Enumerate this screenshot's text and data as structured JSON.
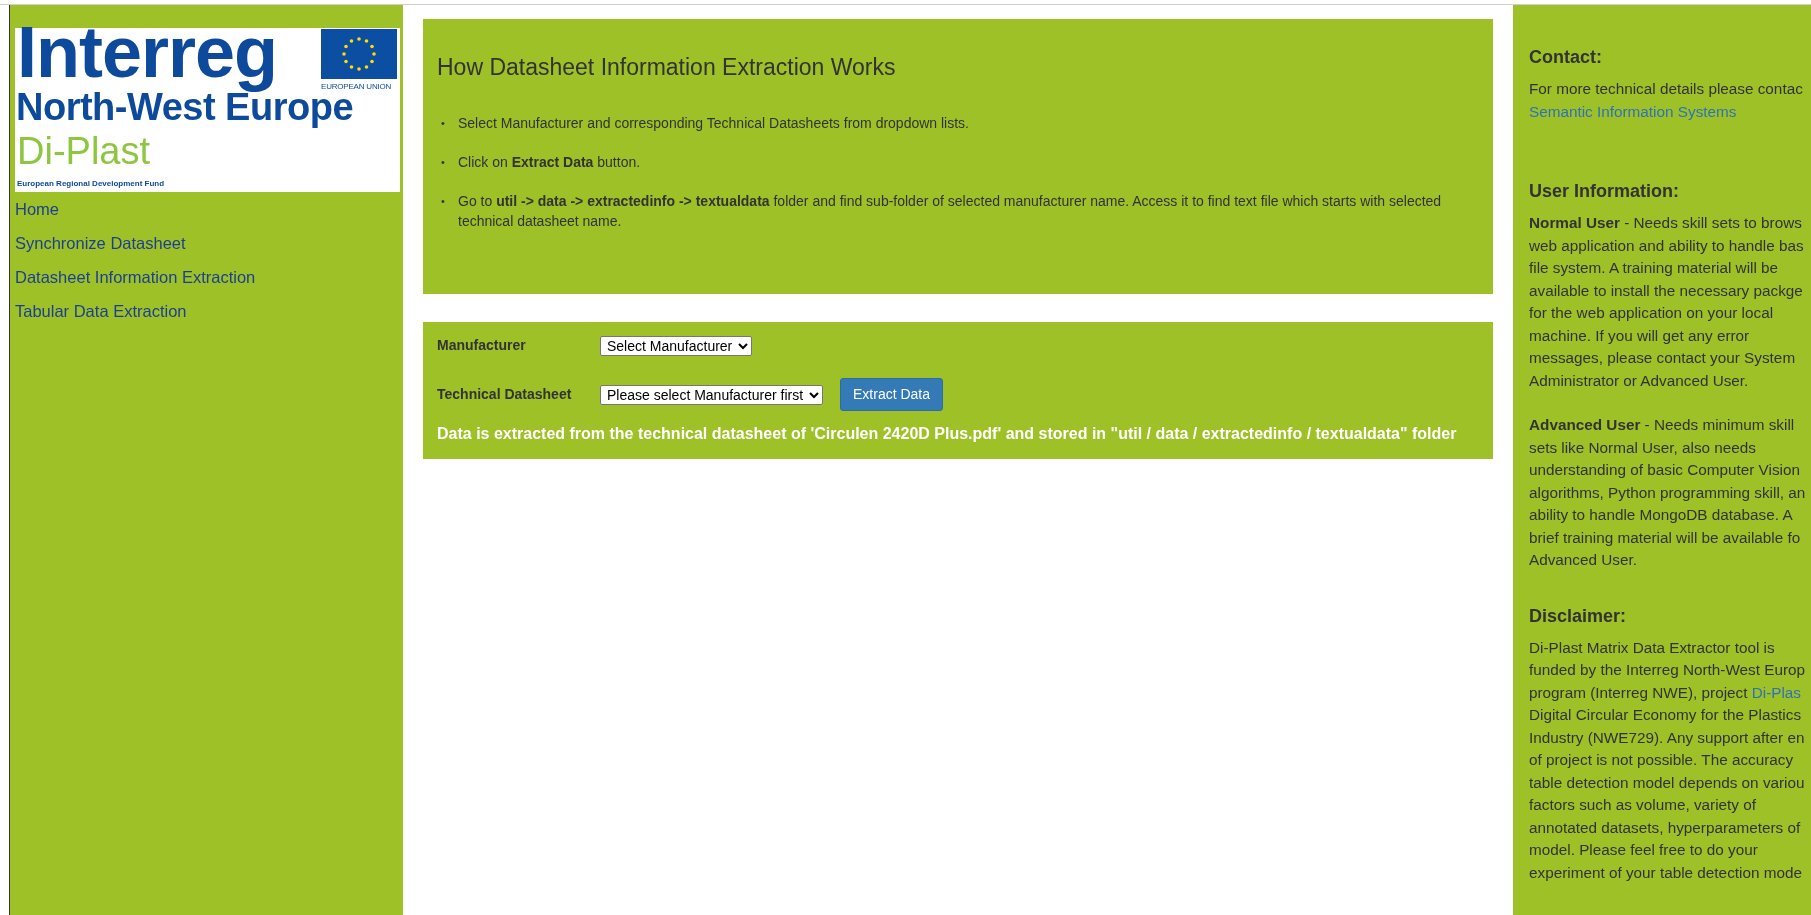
{
  "logo": {
    "title": "Interreg",
    "region": "North-West Europe",
    "project": "Di-Plast",
    "eu_label": "EUROPEAN UNION",
    "fund": "European Regional Development Fund"
  },
  "nav": [
    {
      "label": "Home"
    },
    {
      "label": "Synchronize Datasheet"
    },
    {
      "label": "Datasheet Information Extraction"
    },
    {
      "label": "Tabular Data Extraction"
    }
  ],
  "info": {
    "title": "How Datasheet Information Extraction Works",
    "steps": [
      {
        "marker": "•",
        "text": "Select Manufacturer and corresponding Technical Datasheets from dropdown lists."
      },
      {
        "marker": "•",
        "text": "Click on **Extract Data** button."
      },
      {
        "marker": "•",
        "text": "Go to **util -> data -> extractedinfo -> textualdata** folder and find sub-folder of selected manufacturer name. Access it to find text file which starts with selected technical datasheet name."
      }
    ]
  },
  "form": {
    "fields": [
      {
        "label": "Manufacturer",
        "value": "Select Manufacturer"
      },
      {
        "label": "Technical Datasheet",
        "value": "Please select Manufacturer first"
      }
    ],
    "button": "Extract Data",
    "message": "Data is extracted from the technical datasheet of 'Circulen 2420D Plus.pdf' and stored in \"util / data / extractedinfo / textualdata\" folder"
  },
  "sidebar": [
    {
      "heading": "Contact:",
      "lines": [
        {
          "text": "For more technical details please contac"
        }
      ],
      "link_line": "Semantic Information Systems"
    },
    {
      "heading": "User Information:",
      "paragraphs": [
        [
          "**Normal User** - Needs skill sets to brows",
          "web application and ability to handle bas",
          "file system. A training material will be",
          "available to install the necessary packge",
          "for the web application on your local",
          "machine. If you will get any error",
          "messages, please contact your System",
          "Administrator or Advanced User."
        ],
        [
          "**Advanced User** - Needs minimum skill",
          "sets like Normal User, also needs",
          "understanding of basic Computer Vision",
          "algorithms, Python programming skill, an",
          "ability to handle MongoDB database. A",
          "brief training material will be available fo",
          "Advanced User."
        ]
      ]
    },
    {
      "heading": "Disclaimer:",
      "lines": [
        {
          "text": "Di-Plast Matrix Data Extractor tool is"
        },
        {
          "text": "funded by the Interreg North-West Europ"
        },
        {
          "text": "program (Interreg NWE), project ",
          "link": "Di-Plas"
        },
        {
          "text": "Digital Circular Economy for the Plastics"
        },
        {
          "text": "Industry (NWE729). Any support after en"
        },
        {
          "text": "of project is not possible. The accuracy"
        },
        {
          "text": "table detection model depends on variou"
        },
        {
          "text": "factors such as volume, variety of"
        },
        {
          "text": "annotated datasets, hyperparameters of"
        },
        {
          "text": "model. Please feel free to do your"
        },
        {
          "text": "experiment of your table detection mode"
        }
      ]
    }
  ]
}
